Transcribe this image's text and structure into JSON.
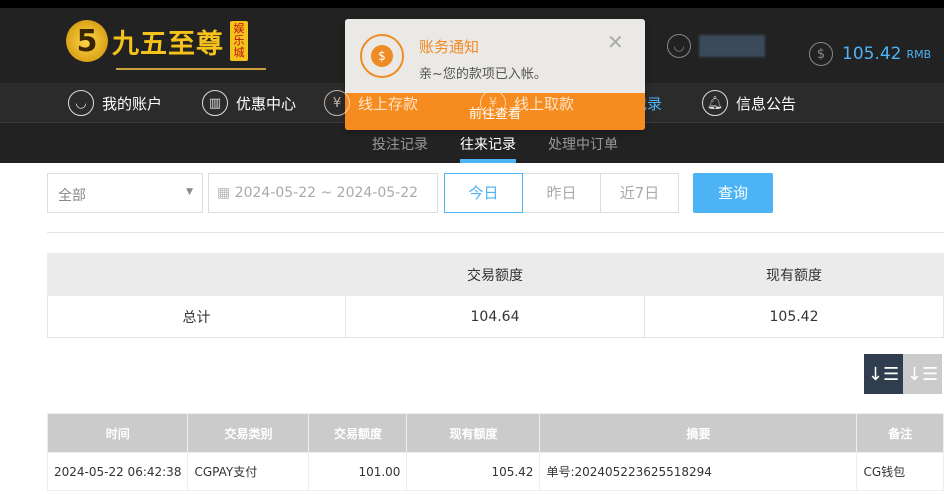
{
  "header": {
    "logo_text": "九五至尊",
    "logo_badge": "娱乐城",
    "logo_digit": "5",
    "balance": "105.42",
    "currency": "RMB"
  },
  "nav": [
    {
      "label": "我的账户",
      "icon": "user-icon"
    },
    {
      "label": "优惠中心",
      "icon": "gift-icon"
    },
    {
      "label": "线上存款",
      "icon": "deposit-icon"
    },
    {
      "label": "线上取款",
      "icon": "withdraw-icon"
    },
    {
      "label": "往来记录",
      "icon": "records-icon"
    },
    {
      "label": "信息公告",
      "icon": "bell-icon"
    }
  ],
  "subnav": [
    "投注记录",
    "往来记录",
    "处理中订单"
  ],
  "popup": {
    "title": "账务通知",
    "message": "亲~您的款项已入帐。",
    "button": "前往查看",
    "close": "✕"
  },
  "filters": {
    "type": "全部",
    "date_range": "2024-05-22 ~ 2024-05-22",
    "quick": [
      "今日",
      "昨日",
      "近7日"
    ],
    "query": "查询"
  },
  "summary": {
    "headers": [
      "",
      "交易额度",
      "现有额度"
    ],
    "row": [
      "总计",
      "104.64",
      "105.42"
    ]
  },
  "table": {
    "headers": [
      "时间",
      "交易类别",
      "交易额度",
      "现有额度",
      "摘要",
      "备注"
    ],
    "rows": [
      [
        "2024-05-22 06:42:38",
        "CGPAY支付",
        "101.00",
        "105.42",
        "单号:202405223625518294",
        "CG钱包"
      ]
    ]
  },
  "colors": {
    "accent": "#4cb3f5",
    "orange": "#f68b1f",
    "gold": "#f5c21b"
  }
}
